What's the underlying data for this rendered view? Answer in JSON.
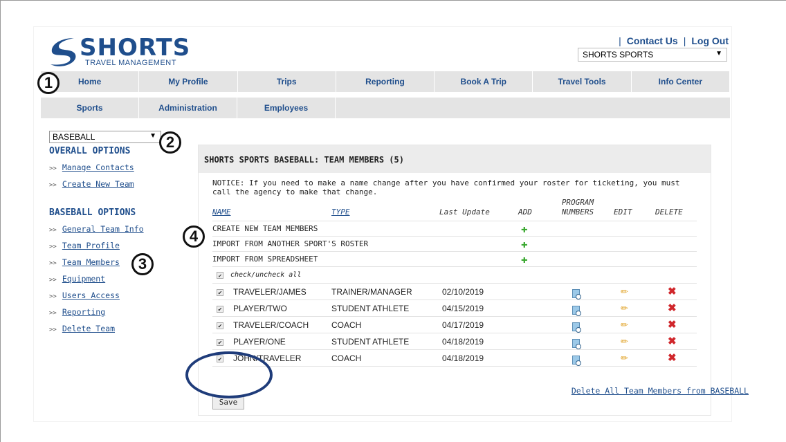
{
  "header": {
    "logo_text": "SHORTS",
    "logo_sub": "TRAVEL MANAGEMENT",
    "links": [
      "Contact Us",
      "Log Out"
    ],
    "account_select": "SHORTS SPORTS"
  },
  "nav_primary": [
    "Home",
    "My Profile",
    "Trips",
    "Reporting",
    "Book A Trip",
    "Travel Tools",
    "Info Center"
  ],
  "nav_secondary": [
    "Sports",
    "Administration",
    "Employees"
  ],
  "annotations": [
    "1",
    "2",
    "3",
    "4"
  ],
  "sidebar": {
    "sport_select": "BASEBALL",
    "overall_heading": "OVERALL OPTIONS",
    "overall_items": [
      "Manage Contacts",
      "Create New Team"
    ],
    "baseball_heading": "BASEBALL OPTIONS",
    "baseball_items": [
      "General Team Info",
      "Team Profile",
      "Team Members",
      "Equipment",
      "Users Access",
      "Reporting",
      "Delete Team"
    ]
  },
  "panel": {
    "title": "SHORTS SPORTS BASEBALL: TEAM MEMBERS (5)",
    "notice": "NOTICE: If you need to make a name change after you have confirmed your roster for ticketing, you must call the agency to make that change.",
    "columns": {
      "name": "NAME",
      "type": "TYPE",
      "last_update": "Last Update",
      "add": "ADD",
      "program": "PROGRAM NUMBERS",
      "edit": "EDIT",
      "delete": "DELETE"
    },
    "add_rows": [
      "CREATE NEW TEAM MEMBERS",
      "IMPORT FROM ANOTHER SPORT'S ROSTER",
      "IMPORT FROM SPREADSHEET"
    ],
    "check_all": "check/uncheck all",
    "members": [
      {
        "name": "TRAVELER/JAMES",
        "type": "TRAINER/MANAGER",
        "date": "02/10/2019"
      },
      {
        "name": "PLAYER/TWO",
        "type": "STUDENT ATHLETE",
        "date": "04/15/2019"
      },
      {
        "name": "TRAVELER/COACH",
        "type": "COACH",
        "date": "04/17/2019"
      },
      {
        "name": "PLAYER/ONE",
        "type": "STUDENT ATHLETE",
        "date": "04/18/2019"
      },
      {
        "name": "JOHN/TRAVELER",
        "type": "COACH",
        "date": "04/18/2019"
      }
    ],
    "save_label": "Save",
    "delete_all": "Delete All Team Members from BASEBALL"
  },
  "colors": {
    "brand": "#1f4e8c",
    "add": "#3aa830",
    "delete": "#d0262b",
    "ring": "#1f3c7a"
  }
}
